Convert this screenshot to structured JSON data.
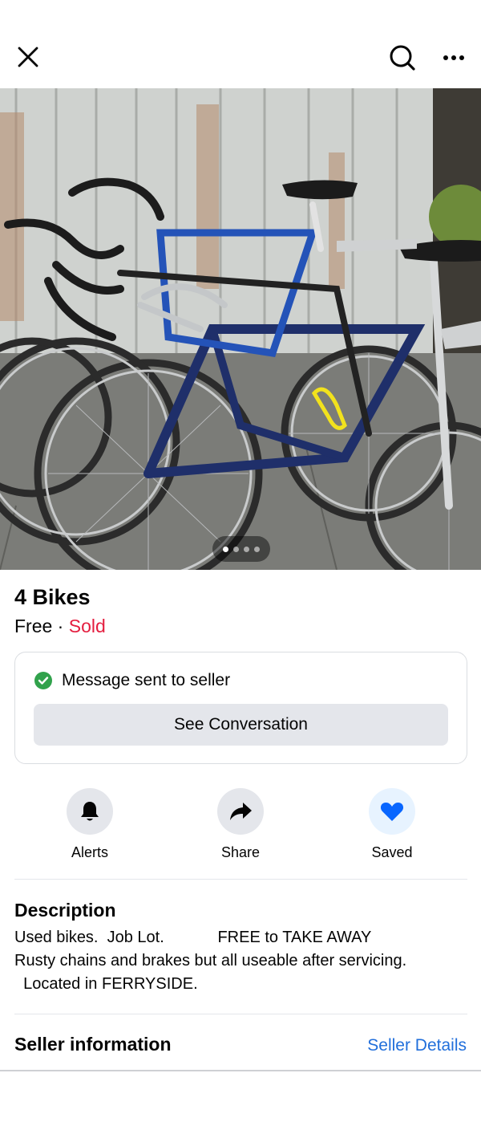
{
  "header": {
    "close_icon": "close-icon",
    "search_icon": "search-icon",
    "more_icon": "more-icon"
  },
  "photo": {
    "description_icon": "listing-photo",
    "page_count": 4,
    "current_page": 1
  },
  "listing": {
    "title": "4 Bikes",
    "price": "Free",
    "separator": " · ",
    "status": "Sold",
    "status_color": "#e41e3f"
  },
  "message_card": {
    "status_text": "Message sent to seller",
    "status_icon": "check-circle-icon",
    "button_label": "See Conversation"
  },
  "actions": [
    {
      "label": "Alerts",
      "icon": "bell-icon"
    },
    {
      "label": "Share",
      "icon": "share-arrow-icon"
    },
    {
      "label": "Saved",
      "icon": "heart-icon",
      "color": "#0866ff"
    }
  ],
  "description": {
    "heading": "Description",
    "body": "Used bikes.  Job Lot.            FREE to TAKE AWAY\nRusty chains and brakes but all useable after servicing.\n  Located in FERRYSIDE."
  },
  "seller": {
    "heading": "Seller information",
    "link": "Seller Details",
    "link_color": "#216fdb"
  }
}
